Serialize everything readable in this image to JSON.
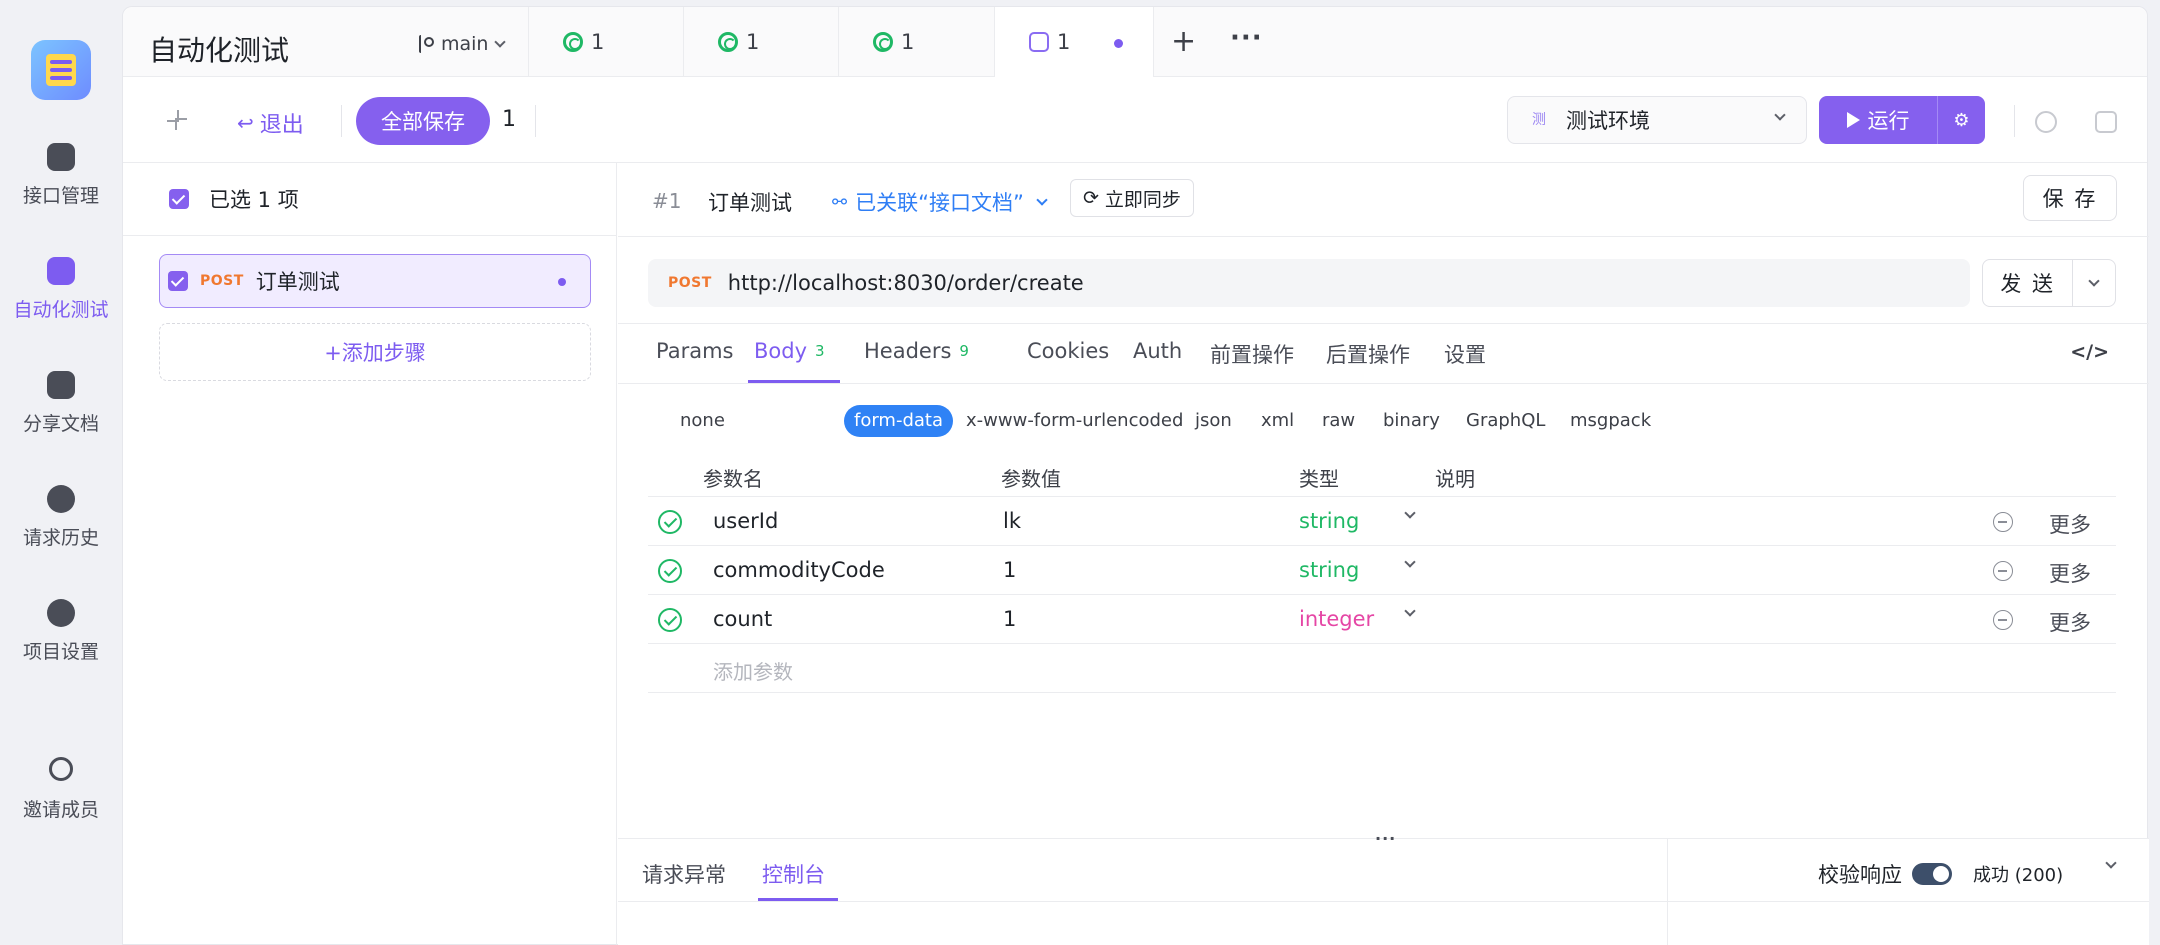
{
  "sidebar": {
    "items": [
      {
        "label": "接口管理",
        "icon": "api-icon"
      },
      {
        "label": "自动化测试",
        "icon": "database-icon",
        "active": true
      },
      {
        "label": "分享文档",
        "icon": "book-icon"
      },
      {
        "label": "请求历史",
        "icon": "clock-icon"
      },
      {
        "label": "项目设置",
        "icon": "hexagon-icon"
      },
      {
        "label": "邀请成员",
        "icon": "user-plus-icon"
      }
    ]
  },
  "tabbar": {
    "title": "自动化测试",
    "branch": "main",
    "tabs": [
      {
        "label": "1",
        "icon": "test-case-icon"
      },
      {
        "label": "1",
        "icon": "test-case-icon"
      },
      {
        "label": "1",
        "icon": "test-case-icon"
      },
      {
        "label": "1",
        "icon": "test-scenario-icon",
        "active": true,
        "unsaved": true
      }
    ],
    "plus": "+",
    "more": "···"
  },
  "toolbar": {
    "exit_label": "退出",
    "save_all_label": "全部保存",
    "save_all_count": "1",
    "env_badge": "测",
    "env_label": "测试环境",
    "run_label": "运行"
  },
  "steps": {
    "selected_text": "已选 1 项",
    "items": [
      {
        "method": "POST",
        "name": "订单测试"
      }
    ],
    "add_step_label": "+添加步骤"
  },
  "detail": {
    "step_no": "#1",
    "step_title": "订单测试",
    "linked_label": "已关联“接口文档”",
    "sync_label": "立即同步",
    "save_label": "保 存",
    "method": "POST",
    "url": "http://localhost:8030/order/create",
    "send_label": "发 送",
    "tabs": [
      {
        "label": "Params"
      },
      {
        "label": "Body",
        "count": "3",
        "active": true
      },
      {
        "label": "Headers",
        "count": "9"
      },
      {
        "label": "Cookies"
      },
      {
        "label": "Auth"
      },
      {
        "label": "前置操作"
      },
      {
        "label": "后置操作"
      },
      {
        "label": "设置"
      }
    ],
    "code_label": "</>",
    "body_types": [
      "none",
      "form-data",
      "x-www-form-urlencoded",
      "json",
      "xml",
      "raw",
      "binary",
      "GraphQL",
      "msgpack"
    ],
    "body_type_selected": "form-data",
    "params_headers": [
      "参数名",
      "参数值",
      "类型",
      "说明"
    ],
    "params": [
      {
        "name": "userId",
        "value": "lk",
        "type": "string",
        "desc": "",
        "more": "更多"
      },
      {
        "name": "commodityCode",
        "value": "1",
        "type": "string",
        "desc": "",
        "more": "更多"
      },
      {
        "name": "count",
        "value": "1",
        "type": "integer",
        "desc": "",
        "more": "更多"
      }
    ],
    "add_param_placeholder": "添加参数"
  },
  "bottom": {
    "tabs": [
      {
        "label": "请求异常"
      },
      {
        "label": "控制台",
        "active": true
      }
    ],
    "verify_label": "校验响应",
    "verify_on": true,
    "status": "成功 (200)"
  },
  "colors": {
    "accent": "#7d5cf0",
    "post_method": "#f07830",
    "link_blue": "#2f7ef5",
    "type_string": "#1fb865",
    "type_integer": "#e546a5"
  }
}
